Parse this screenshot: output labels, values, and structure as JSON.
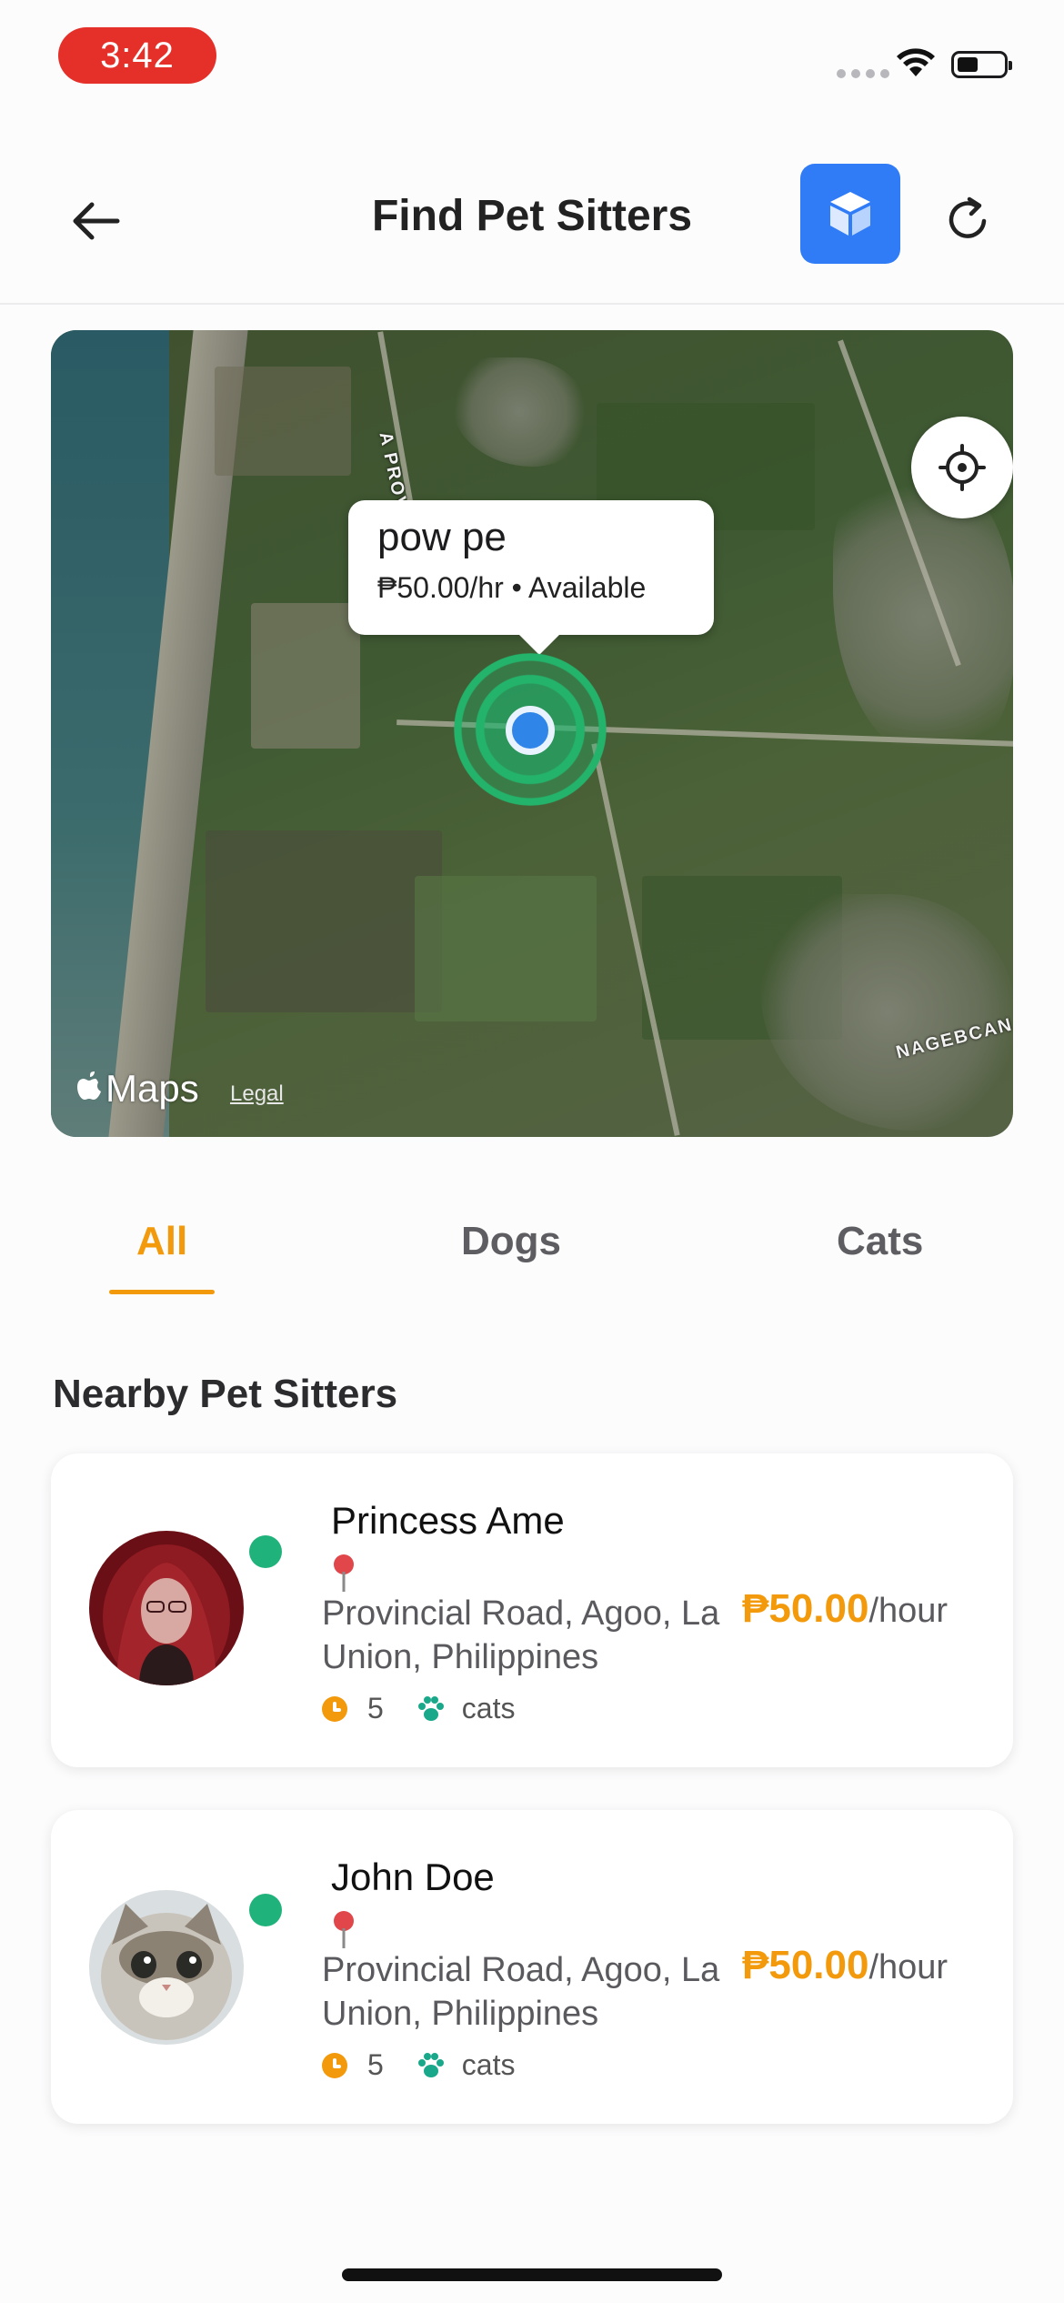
{
  "status_bar": {
    "time": "3:42"
  },
  "header": {
    "title": "Find Pet Sitters"
  },
  "map": {
    "callout": {
      "name": "pow pe",
      "detail": "₱50.00/hr • Available"
    },
    "labels": {
      "road": "A PROVINCIAL",
      "town": "NAGEBCAN"
    },
    "attribution": {
      "brand": "Maps",
      "legal": "Legal"
    }
  },
  "tabs": [
    {
      "label": "All",
      "active": true
    },
    {
      "label": "Dogs",
      "active": false
    },
    {
      "label": "Cats",
      "active": false
    }
  ],
  "section": {
    "title": "Nearby Pet Sitters"
  },
  "sitters": [
    {
      "name": "Princess Ame",
      "address": "Provincial Road, Agoo, La Union, Philippines",
      "price": "₱50.00",
      "unit": "/hour",
      "experience": "5",
      "pets": "cats",
      "online": true
    },
    {
      "name": "John Doe",
      "address": "Provincial Road, Agoo, La Union, Philippines",
      "price": "₱50.00",
      "unit": "/hour",
      "experience": "5",
      "pets": "cats",
      "online": true
    }
  ],
  "colors": {
    "accent": "#f29a0c",
    "primary_button": "#2f7cf6",
    "online": "#20b27b",
    "marker": "#23b36b"
  }
}
